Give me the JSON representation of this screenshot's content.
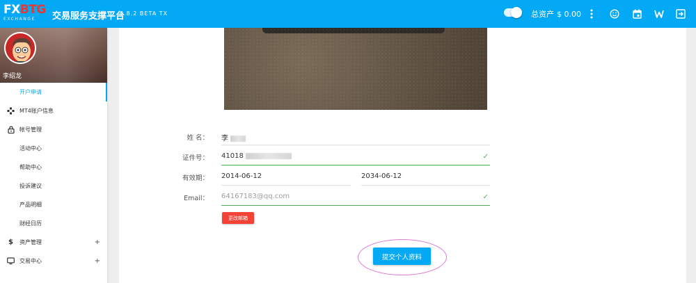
{
  "header": {
    "logo_prefix": "FX",
    "logo_accent": "BTG",
    "logo_sub": "EXCHANGE",
    "title": "交易服务支撑平台",
    "version": "0.8.2 BETA TX",
    "total_assets_label": "总资产",
    "total_assets_value": "$ 0.00",
    "toggle_on": true,
    "icons": [
      "more-vert-icon",
      "smiley-icon",
      "calendar-icon",
      "w-icon",
      "logout-icon"
    ]
  },
  "user": {
    "name": "李绍龙"
  },
  "sidebar": {
    "items": [
      {
        "label": "开户申请",
        "icon": "",
        "active": true,
        "expandable": false
      },
      {
        "label": "MT4账户信息",
        "icon": "gamepad-icon",
        "active": false,
        "expandable": false
      },
      {
        "label": "帐号管理",
        "icon": "lock-icon",
        "active": false,
        "expandable": false
      },
      {
        "label": "活动中心",
        "icon": "",
        "active": false,
        "expandable": false
      },
      {
        "label": "帮助中心",
        "icon": "",
        "active": false,
        "expandable": false
      },
      {
        "label": "投诉建议",
        "icon": "",
        "active": false,
        "expandable": false
      },
      {
        "label": "产品明细",
        "icon": "",
        "active": false,
        "expandable": false
      },
      {
        "label": "财经日历",
        "icon": "",
        "active": false,
        "expandable": false
      },
      {
        "label": "资产管理",
        "icon": "dollar-icon",
        "active": false,
        "expandable": true
      },
      {
        "label": "交易中心",
        "icon": "monitor-icon",
        "active": false,
        "expandable": true
      }
    ],
    "expand_symbol": "+"
  },
  "form": {
    "name_label": "姓 名：",
    "name_value": "李",
    "id_label": "证件号：",
    "id_value": "41018",
    "validity_label": "有效期：",
    "validity_from": "2014-06-12",
    "validity_to": "2034-06-12",
    "email_label": "Email：",
    "email_value": "64167183@qq.com",
    "check_symbol": "✓",
    "change_email_button": "更改邮箱",
    "submit_button": "提交个人资料"
  },
  "colors": {
    "primary": "#03a9f4",
    "danger": "#f44336",
    "success": "#4caf50",
    "highlight_ring": "#e07ad6"
  }
}
